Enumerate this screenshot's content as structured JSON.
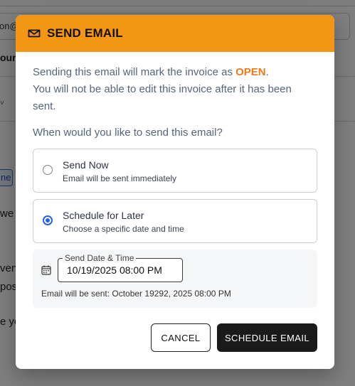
{
  "background": {
    "email_fragment": "on@",
    "bold_fragment": "our",
    "caret": "˅",
    "tag_fragment": "ne",
    "text1": "we",
    "text2": "ven",
    "text3": "pos",
    "text4": "e yo"
  },
  "modal": {
    "title": "SEND EMAIL",
    "accent_color": "#f39515",
    "warning_prefix": "Sending this email will mark the invoice as ",
    "status_word": "OPEN",
    "warning_suffix": ".",
    "warning_line2": "You will not be able to edit this invoice after it has been sent.",
    "question": "When would you like to send this email?",
    "options": [
      {
        "title": "Send Now",
        "subtitle": "Email will be sent immediately",
        "selected": false
      },
      {
        "title": "Schedule for Later",
        "subtitle": "Choose a specific date and time",
        "selected": true
      }
    ],
    "schedule": {
      "label": "Send Date & Time",
      "value": "10/19/2025 08:00 PM",
      "sent_text": "Email will be sent: October 19292, 2025 08:00 PM"
    },
    "buttons": {
      "cancel": "CANCEL",
      "primary": "SCHEDULE EMAIL"
    }
  }
}
